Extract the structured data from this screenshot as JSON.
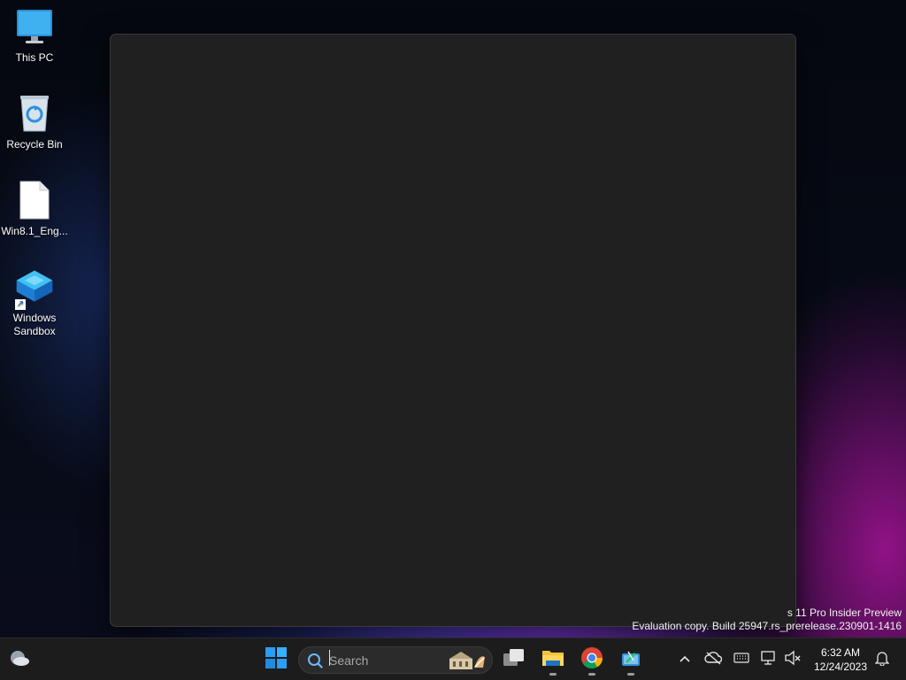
{
  "desktop": {
    "icons": [
      {
        "label": "This PC",
        "icon": "monitor-icon"
      },
      {
        "label": "Recycle Bin",
        "icon": "recycle-bin-icon"
      },
      {
        "label": "Win8.1_Eng...",
        "icon": "file-icon"
      },
      {
        "label": "Windows Sandbox",
        "icon": "sandbox-icon"
      }
    ]
  },
  "watermark": {
    "line1": "s 11 Pro Insider Preview",
    "line2": "Evaluation copy. Build 25947.rs_prerelease.230901-1416"
  },
  "taskbar": {
    "search": {
      "placeholder": "Search",
      "value": ""
    },
    "apps": [
      {
        "name": "Start",
        "icon": "windows-start-icon"
      },
      {
        "name": "Task View",
        "icon": "task-view-icon"
      },
      {
        "name": "File Explorer",
        "icon": "folder-icon"
      },
      {
        "name": "Google Chrome",
        "icon": "chrome-icon"
      },
      {
        "name": "Snipping Tool",
        "icon": "snipping-tool-icon"
      }
    ],
    "clock": {
      "time": "6:32 AM",
      "date": "12/24/2023"
    }
  },
  "colors": {
    "window_bg": "#202020",
    "taskbar_bg": "#1c1c1c",
    "accent_blue": "#1e90ff"
  }
}
